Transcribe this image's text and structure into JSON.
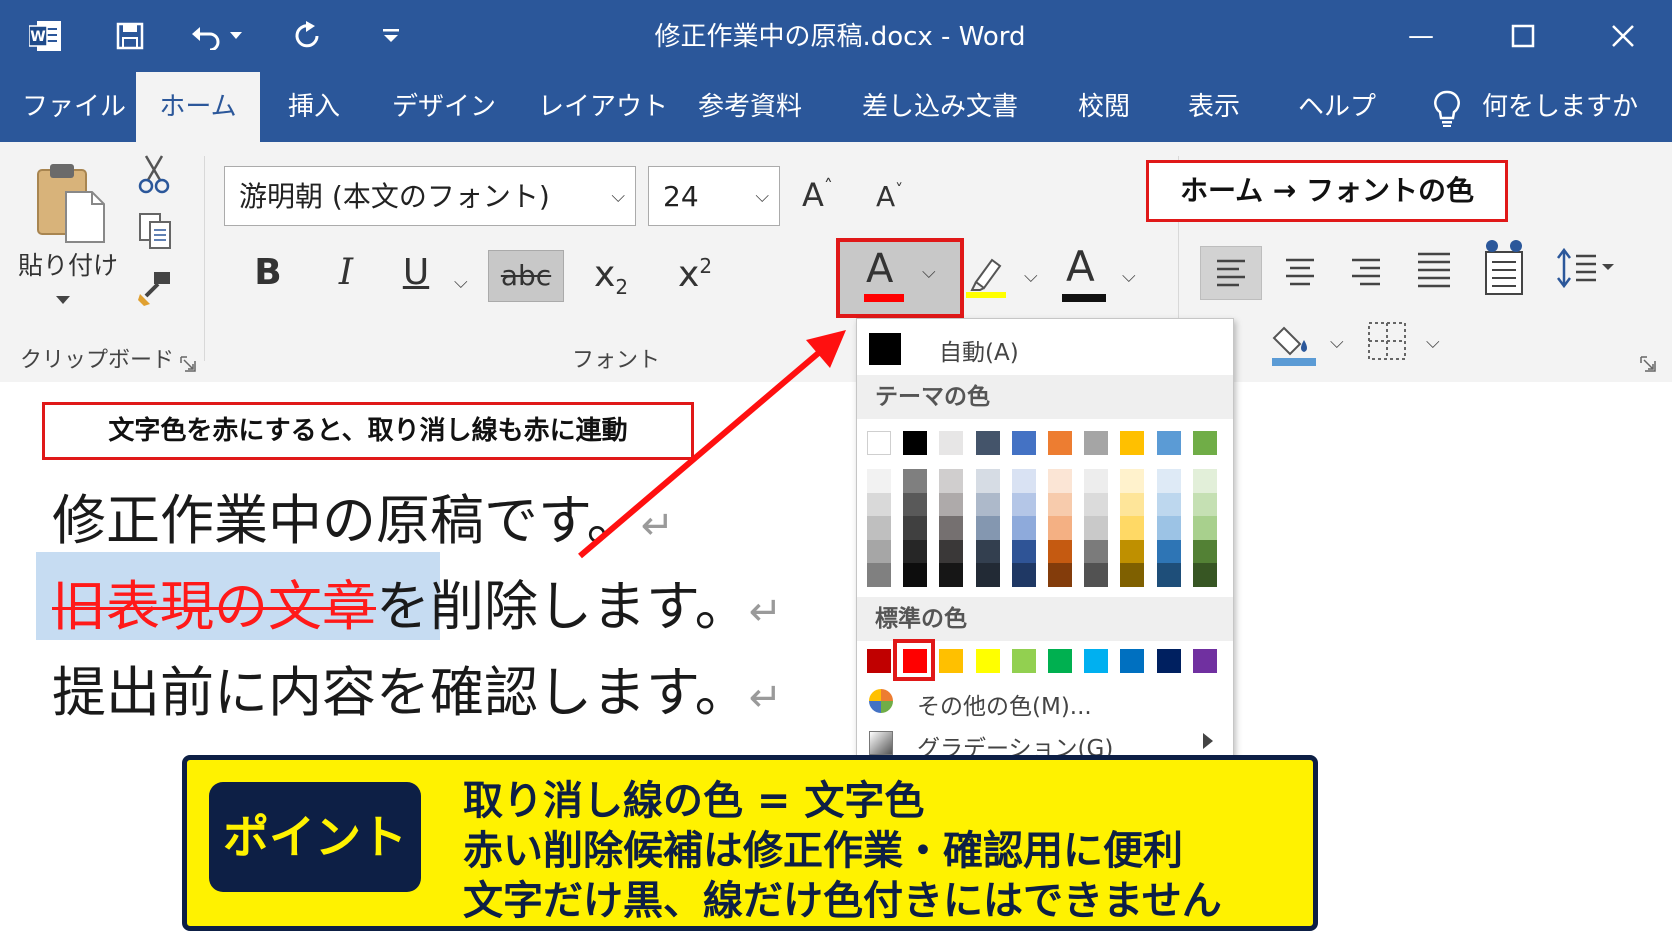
{
  "window": {
    "title": "修正作業中の原稿.docx  -  Word",
    "minimize": "—",
    "maximize": "☐",
    "close": "✕"
  },
  "tabs": [
    {
      "label": "ファイル"
    },
    {
      "label": "ホーム",
      "active": true
    },
    {
      "label": "挿入"
    },
    {
      "label": "デザイン"
    },
    {
      "label": "レイアウト"
    },
    {
      "label": "参考資料"
    },
    {
      "label": "差し込み文書"
    },
    {
      "label": "校閲"
    },
    {
      "label": "表示"
    },
    {
      "label": "ヘルプ"
    }
  ],
  "tell_me": "何をしますか",
  "clipboard": {
    "paste_label": "貼り付け",
    "group_label": "クリップボード"
  },
  "font": {
    "name": "游明朝 (本文のフォント)",
    "size": "24",
    "grow": "A",
    "shrink": "A",
    "bold": "B",
    "italic": "I",
    "underline": "U",
    "strike": "abc",
    "sub_base": "x",
    "sub_idx": "2",
    "sup_base": "x",
    "sup_idx": "2",
    "font_color_letter": "A",
    "text_color_letter": "A",
    "group_label": "フォント"
  },
  "callouts": {
    "top_right": "ホーム → フォントの色",
    "left": "文字色を赤にすると、取り消し線も赤に連動"
  },
  "document": {
    "line1": "修正作業中の原稿です。",
    "line2_strike": "旧表現の文章",
    "line2_rest": "を削除します。",
    "line3": "提出前に内容を確認します。",
    "pilcrow": "↵"
  },
  "color_menu": {
    "auto": "自動(A)",
    "theme_header": "テーマの色",
    "standard_header": "標準の色",
    "more_colors": "その他の色(M)...",
    "gradient": "グラデーション(G)",
    "theme_top": [
      "#ffffff",
      "#000000",
      "#e7e6e6",
      "#44546a",
      "#4472c4",
      "#ed7d31",
      "#a5a5a5",
      "#ffc000",
      "#5b9bd5",
      "#70ad47"
    ],
    "theme_shades": [
      [
        "#f2f2f2",
        "#d9d9d9",
        "#bfbfbf",
        "#a6a6a6",
        "#808080"
      ],
      [
        "#7f7f7f",
        "#595959",
        "#404040",
        "#262626",
        "#0d0d0d"
      ],
      [
        "#d0cece",
        "#aeaaaa",
        "#757070",
        "#3a3838",
        "#161616"
      ],
      [
        "#d6dce4",
        "#adb9ca",
        "#8497b0",
        "#333f4f",
        "#222a35"
      ],
      [
        "#d9e2f3",
        "#b4c6e7",
        "#8eaadb",
        "#2f5496",
        "#1f3864"
      ],
      [
        "#fbe5d5",
        "#f7cbac",
        "#f4b083",
        "#c55a11",
        "#833c0b"
      ],
      [
        "#ededed",
        "#dbdbdb",
        "#c9c9c9",
        "#7b7b7b",
        "#525252"
      ],
      [
        "#fff2cc",
        "#fee599",
        "#ffd965",
        "#bf9000",
        "#7f6000"
      ],
      [
        "#deeaf6",
        "#bdd7ee",
        "#9cc3e5",
        "#2e75b5",
        "#1e4e79"
      ],
      [
        "#e2efd9",
        "#c5e0b3",
        "#a8d08d",
        "#538135",
        "#375623"
      ]
    ],
    "standard": [
      "#c00000",
      "#ff0000",
      "#ffc000",
      "#ffff00",
      "#92d050",
      "#00b050",
      "#00b0f0",
      "#0070c0",
      "#002060",
      "#7030a0"
    ],
    "selected_standard_index": 1
  },
  "point": {
    "badge": "ポイント",
    "line1": "取り消し線の色 = 文字色",
    "line2": "赤い削除候補は修正作業・確認用に便利",
    "line3": "文字だけ黒、線だけ色付きにはできません"
  },
  "colors": {
    "word_blue": "#2b579a",
    "callout_red": "#e01818",
    "point_yellow": "#fff200",
    "point_navy": "#0d1f45",
    "selection": "#c6dcf2"
  }
}
